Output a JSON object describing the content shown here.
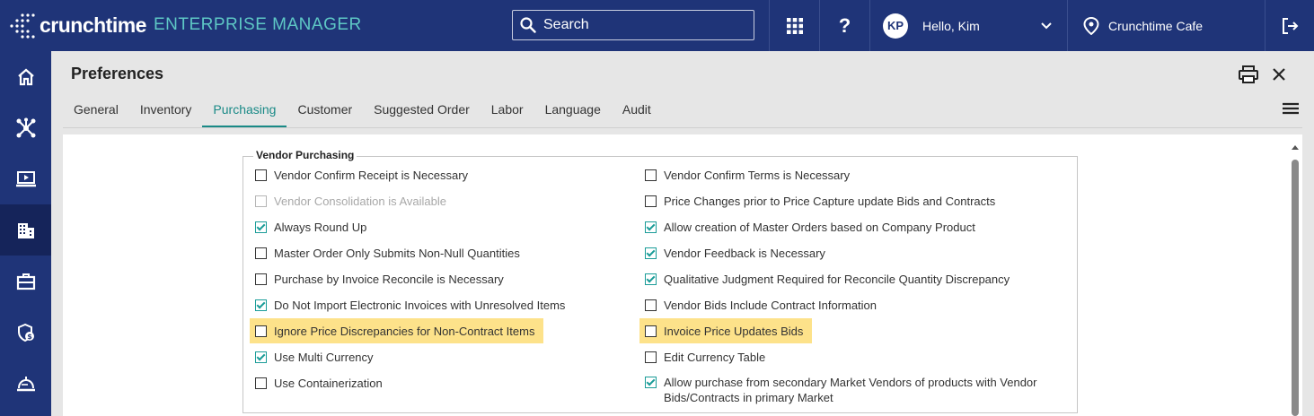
{
  "topbar": {
    "brand": "crunchtime",
    "product": "ENTERPRISE MANAGER",
    "search_placeholder": "Search",
    "avatar_initials": "KP",
    "greeting": "Hello, Kim",
    "location": "Crunchtime Cafe",
    "icons": [
      "search-icon",
      "apps-grid-icon",
      "help-icon",
      "chevron-down-icon",
      "location-pin-icon",
      "logout-icon"
    ]
  },
  "sidebar": {
    "items": [
      "home-icon",
      "network-icon",
      "presentation-icon",
      "building-icon",
      "briefcase-icon",
      "shield-dollar-icon",
      "food-service-icon"
    ],
    "active_index": 3
  },
  "page": {
    "title": "Preferences",
    "icons": [
      "print-icon",
      "close-icon",
      "menu-icon"
    ]
  },
  "tabs": [
    {
      "label": "General",
      "active": false
    },
    {
      "label": "Inventory",
      "active": false
    },
    {
      "label": "Purchasing",
      "active": true
    },
    {
      "label": "Customer",
      "active": false
    },
    {
      "label": "Suggested Order",
      "active": false
    },
    {
      "label": "Labor",
      "active": false
    },
    {
      "label": "Language",
      "active": false
    },
    {
      "label": "Audit",
      "active": false
    }
  ],
  "section": {
    "legend": "Vendor Purchasing",
    "left": [
      {
        "label": "Vendor Confirm Receipt is Necessary",
        "checked": false,
        "disabled": false,
        "highlight": false
      },
      {
        "label": "Vendor Consolidation is Available",
        "checked": false,
        "disabled": true,
        "highlight": false
      },
      {
        "label": "Always Round Up",
        "checked": true,
        "disabled": false,
        "highlight": false
      },
      {
        "label": "Master Order Only Submits Non-Null Quantities",
        "checked": false,
        "disabled": false,
        "highlight": false
      },
      {
        "label": "Purchase by Invoice Reconcile is Necessary",
        "checked": false,
        "disabled": false,
        "highlight": false
      },
      {
        "label": "Do Not Import Electronic Invoices with Unresolved Items",
        "checked": true,
        "disabled": false,
        "highlight": false
      },
      {
        "label": "Ignore Price Discrepancies for Non-Contract Items",
        "checked": false,
        "disabled": false,
        "highlight": true
      },
      {
        "label": "Use Multi Currency",
        "checked": true,
        "disabled": false,
        "highlight": false
      },
      {
        "label": "Use Containerization",
        "checked": false,
        "disabled": false,
        "highlight": false
      }
    ],
    "right": [
      {
        "label": "Vendor Confirm Terms is Necessary",
        "checked": false,
        "disabled": false,
        "highlight": false
      },
      {
        "label": "Price Changes prior to Price Capture update Bids and Contracts",
        "checked": false,
        "disabled": false,
        "highlight": false
      },
      {
        "label": "Allow creation of Master Orders based on Company Product",
        "checked": true,
        "disabled": false,
        "highlight": false
      },
      {
        "label": "Vendor Feedback is Necessary",
        "checked": true,
        "disabled": false,
        "highlight": false
      },
      {
        "label": "Qualitative Judgment Required for Reconcile Quantity Discrepancy",
        "checked": true,
        "disabled": false,
        "highlight": false
      },
      {
        "label": "Vendor Bids Include Contract Information",
        "checked": false,
        "disabled": false,
        "highlight": false
      },
      {
        "label": "Invoice Price Updates Bids",
        "checked": false,
        "disabled": false,
        "highlight": true
      },
      {
        "label": "Edit Currency Table",
        "checked": false,
        "disabled": false,
        "highlight": false
      },
      {
        "label": "Allow purchase from secondary Market Vendors of products with Vendor",
        "label_cont": "Bids/Contracts in primary Market",
        "checked": true,
        "disabled": false,
        "highlight": false
      }
    ]
  },
  "colors": {
    "topbar": "#1f3478",
    "accent": "#1a8a87",
    "product_text": "#5ec8c5",
    "highlight": "#fde28a"
  }
}
